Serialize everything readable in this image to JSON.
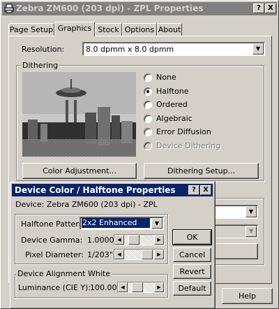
{
  "window": {
    "title": "Zebra ZM600 (203 dpi) - ZPL Properties",
    "help_glyph": "?",
    "close_glyph": "X"
  },
  "tabs": [
    {
      "label": "Page Setup"
    },
    {
      "label": "Graphics",
      "active": true
    },
    {
      "label": "Stock"
    },
    {
      "label": "Options"
    },
    {
      "label": "About"
    }
  ],
  "graphics": {
    "resolution_label": "Resolution:",
    "resolution_value": "8.0 dpmm x 8.0 dpmm",
    "dithering_label": "Dithering",
    "dithering_options": [
      {
        "label": "None",
        "selected": false,
        "enabled": true
      },
      {
        "label": "Halftone",
        "selected": true,
        "enabled": true
      },
      {
        "label": "Ordered",
        "selected": false,
        "enabled": true
      },
      {
        "label": "Algebraic",
        "selected": false,
        "enabled": true
      },
      {
        "label": "Error Diffusion",
        "selected": false,
        "enabled": true
      },
      {
        "label": "Device Dithering",
        "selected": false,
        "enabled": false
      }
    ],
    "color_adjustment_button": "Color Adjustment...",
    "dithering_setup_button": "Dithering Setup..."
  },
  "footer": {
    "help_button": "Help"
  },
  "dialog": {
    "title": "Device Color / Halftone Properties",
    "help_glyph": "?",
    "close_glyph": "X",
    "device_label": "Device: Zebra ZM600 (203 dpi) - ZPL",
    "halftone_pattern_label": "Halftone Pattern:",
    "halftone_pattern_value": "2x2 Enhanced",
    "device_gamma_label": "Device Gamma:",
    "device_gamma_value": "1.0000",
    "pixel_diameter_label": "Pixel Diameter:",
    "pixel_diameter_value": "1/203\"",
    "alignment_group_label": "Device Alignment White",
    "luminance_label": "Luminance (CIE Y):",
    "luminance_value": "100.00",
    "ok_button": "OK",
    "cancel_button": "Cancel",
    "revert_button": "Revert",
    "default_button": "Default"
  },
  "colors": {
    "active_title": "#0a246a",
    "inactive_title": "#808080",
    "face": "#d4d0c8"
  }
}
